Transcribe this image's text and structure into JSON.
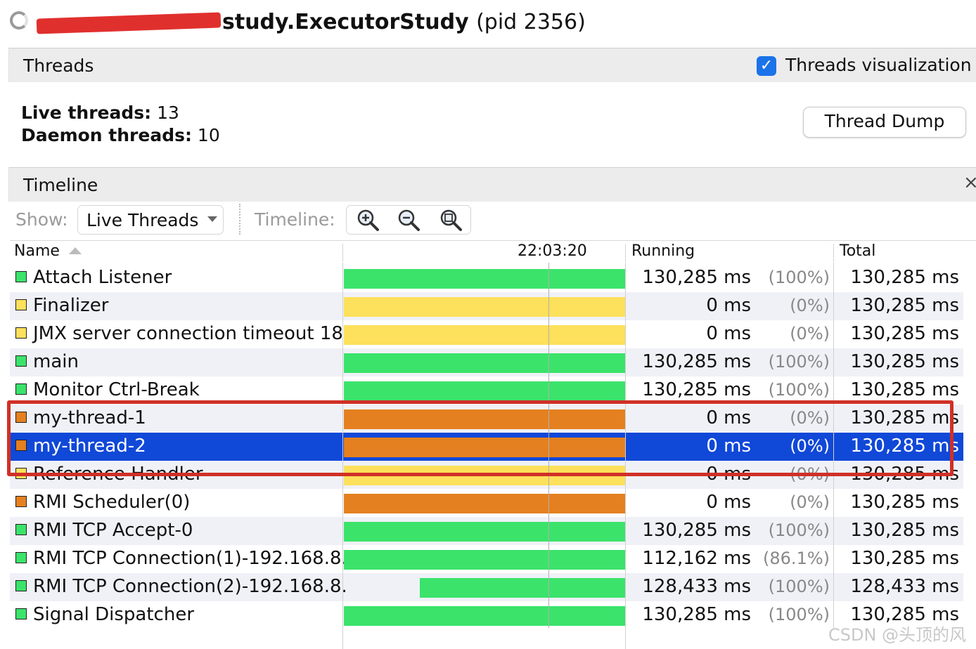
{
  "header": {
    "title": "study.ExecutorStudy",
    "pid": "(pid 2356)"
  },
  "threads_section": {
    "title": "Threads",
    "visualization_label": "Threads visualization",
    "visualization_checked": true,
    "live_label": "Live threads:",
    "live_value": " 13",
    "daemon_label": "Daemon threads:",
    "daemon_value": " 10",
    "thread_dump_button": "Thread Dump"
  },
  "timeline_section": {
    "title": "Timeline",
    "close": "×",
    "show_label": "Show:",
    "show_value": "Live Threads",
    "timeline_label": "Timeline:",
    "zoom_icons": [
      "zoom-in-icon",
      "zoom-out-icon",
      "zoom-fit-icon"
    ]
  },
  "table": {
    "columns": {
      "name": "Name",
      "time": "22:03:20",
      "running": "Running",
      "total": "Total"
    },
    "state_colors": {
      "running": "#3be36b",
      "waiting": "#fde05b",
      "parked": "#e4801f",
      "selected": "#1048d8"
    },
    "rows": [
      {
        "name": "Attach Listener",
        "running": "130,285 ms",
        "pct": "(100%)",
        "total": "130,285 ms",
        "state": "running",
        "start": 0.0
      },
      {
        "name": "Finalizer",
        "running": "0 ms",
        "pct": "(0%)",
        "total": "130,285 ms",
        "state": "waiting",
        "start": 0.0
      },
      {
        "name": "JMX server connection timeout 18",
        "running": "0 ms",
        "pct": "(0%)",
        "total": "130,285 ms",
        "state": "waiting",
        "start": 0.0
      },
      {
        "name": "main",
        "running": "130,285 ms",
        "pct": "(100%)",
        "total": "130,285 ms",
        "state": "running",
        "start": 0.0
      },
      {
        "name": "Monitor Ctrl-Break",
        "running": "130,285 ms",
        "pct": "(100%)",
        "total": "130,285 ms",
        "state": "running",
        "start": 0.0
      },
      {
        "name": "my-thread-1",
        "running": "0 ms",
        "pct": "(0%)",
        "total": "130,285 ms",
        "state": "parked",
        "start": 0.0
      },
      {
        "name": "my-thread-2",
        "running": "0 ms",
        "pct": "(0%)",
        "total": "130,285 ms",
        "state": "parked",
        "start": 0.0,
        "selected": true
      },
      {
        "name": "Reference Handler",
        "running": "0 ms",
        "pct": "(0%)",
        "total": "130,285 ms",
        "state": "waiting",
        "start": 0.0
      },
      {
        "name": "RMI Scheduler(0)",
        "running": "0 ms",
        "pct": "(0%)",
        "total": "130,285 ms",
        "state": "parked",
        "start": 0.0
      },
      {
        "name": "RMI TCP Accept-0",
        "running": "130,285 ms",
        "pct": "(100%)",
        "total": "130,285 ms",
        "state": "running",
        "start": 0.0
      },
      {
        "name": "RMI TCP Connection(1)-192.168.8.",
        "running": "112,162 ms",
        "pct": "(86.1%)",
        "total": "130,285 ms",
        "state": "running",
        "start": 0.0
      },
      {
        "name": "RMI TCP Connection(2)-192.168.8.",
        "running": "128,433 ms",
        "pct": "(100%)",
        "total": "128,433 ms",
        "state": "running",
        "start": 0.27
      },
      {
        "name": "Signal Dispatcher",
        "running": "130,285 ms",
        "pct": "(100%)",
        "total": "130,285 ms",
        "state": "running",
        "start": 0.0
      }
    ]
  },
  "watermark": "CSDN @头顶的风"
}
